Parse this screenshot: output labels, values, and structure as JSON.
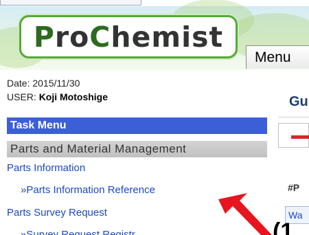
{
  "header": {
    "logo_text_cap1": "P",
    "logo_text_part1": "ro",
    "logo_text_cap2": "C",
    "logo_text_part2": "hemist",
    "menu_tab_label": "Menu"
  },
  "user_info": {
    "date_label": "Date: ",
    "date_value": "2015/11/30",
    "user_label": "USER: ",
    "user_value": "Koji Motoshige"
  },
  "sidebar": {
    "header": "Task Menu",
    "section": "Parts and Material Management",
    "items": [
      {
        "label": "Parts Information"
      },
      {
        "label": "»Parts Information Reference"
      },
      {
        "label": "Parts Survey Request"
      },
      {
        "label": "»Survey Request Registr..."
      }
    ]
  },
  "main": {
    "title_fragment": "Gu",
    "label_fragment": "#P",
    "box_fragment": "Wa"
  },
  "annotation": {
    "label": "(1"
  },
  "colors": {
    "task_menu_bg": "#3b5fd6",
    "link": "#1b49c4",
    "arrow": "#e8141e",
    "logo_border": "#58a83a"
  }
}
